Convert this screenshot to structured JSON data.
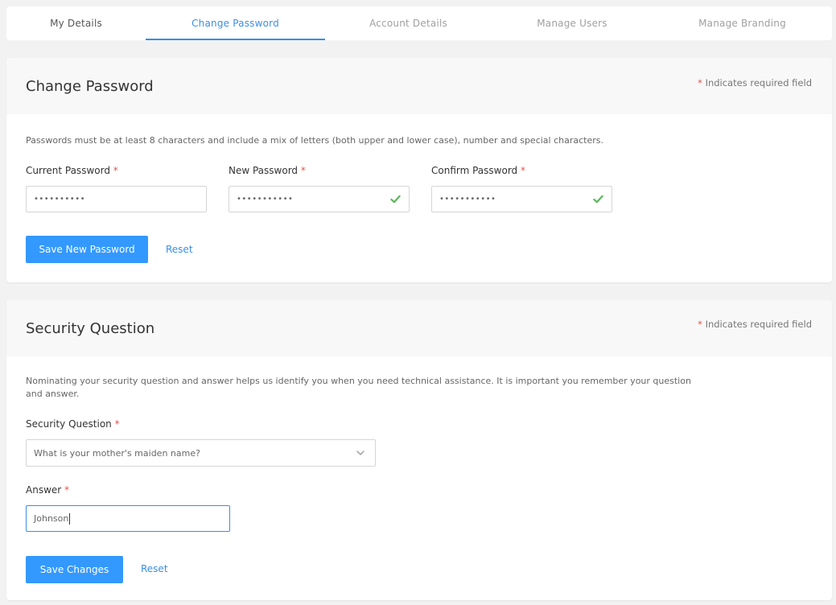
{
  "tabs": [
    {
      "label": "My Details",
      "state": "normal"
    },
    {
      "label": "Change Password",
      "state": "active"
    },
    {
      "label": "Account Details",
      "state": "muted"
    },
    {
      "label": "Manage Users",
      "state": "muted"
    },
    {
      "label": "Manage Branding",
      "state": "muted"
    }
  ],
  "colors": {
    "accent": "#3a8ee6",
    "button": "#3399ff",
    "required": "#e0524c",
    "valid": "#5cb85c"
  },
  "change_password": {
    "title": "Change Password",
    "required_star": "*",
    "required_note": "Indicates required field",
    "description": "Passwords must be at least 8 characters and include a mix of letters (both upper and lower case), number and special characters.",
    "current_label": "Current Password",
    "current_value": "••••••••••",
    "new_label": "New Password",
    "new_value": "•••••••••••",
    "new_valid_icon": "check-icon",
    "confirm_label": "Confirm Password",
    "confirm_value": "•••••••••••",
    "confirm_valid_icon": "check-icon",
    "save_label": "Save New Password",
    "reset_label": "Reset"
  },
  "security_question": {
    "title": "Security Question",
    "required_star": "*",
    "required_note": "Indicates required field",
    "description": "Nominating your security question and answer helps us identify you when you need technical assistance. It is important you remember your question and answer.",
    "question_label": "Security Question",
    "question_value": "What is your mother's maiden name?",
    "answer_label": "Answer",
    "answer_value": "Johnson",
    "save_label": "Save Changes",
    "reset_label": "Reset"
  }
}
